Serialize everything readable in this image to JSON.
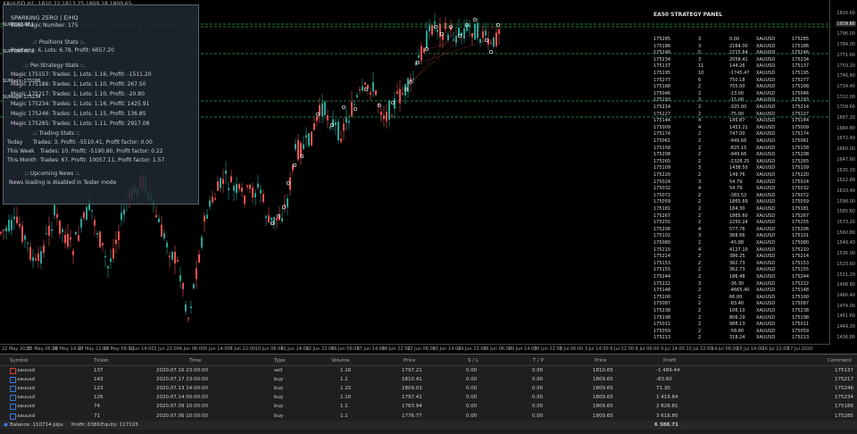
{
  "window": {
    "title": "XAUUSD,H1: 1810.22 1813.25 1809.18 1809.65"
  },
  "info_panel": {
    "header": "SPARKING ZERO | E/HQ",
    "base_magic": "Base Magic Number: 175",
    "positions_title": ".:: Positions Stats ::.",
    "positions_stat": "Positions: 6, Lots: 6.78, Profit: 6657.20",
    "per_strategy_title": ".:: Per-Strategy Stats ::.",
    "strategies": [
      "Magic 175157: Trades: 1, Lots: 1.16, Profit: -1511.20",
      "Magic 175186: Trades: 1, Lots: 1.10, Profit: 267.50",
      "Magic 175217: Trades: 1, Lots: 1.10, Profit: -20.80",
      "Magic 175234: Trades: 1, Lots: 1.16, Profit: 1425.91",
      "Magic 175246: Trades: 1, Lots: 1.15, Profit: 136.85",
      "Magic 175285: Trades: 1, Lots: 1.11, Profit: 2917.08"
    ],
    "trading_title": ".:: Trading Stats ::.",
    "trading": [
      {
        "label": "Today",
        "value": "Trades: 3, Profit: -5510.41, Profit factor: 0.00"
      },
      {
        "label": "This Week",
        "value": "Trades: 10, Profit: -5190.80, Profit factor: 0.22"
      },
      {
        "label": "This Month",
        "value": "Trades: 67, Profit: 10057.11, Profit factor: 1.57"
      }
    ],
    "news_title": ".:: Upcoming News ::.",
    "news_text": "News loading is disabled in Tester mode"
  },
  "chart_left_labels": [
    "SUPPORT-RT-1",
    "SUPPORT-RT-2",
    "SUMagic-175186",
    "SUMagic-175234"
  ],
  "strategy_panel": {
    "title": "EA50 STRATEGY PANEL",
    "rows": [
      [
        "175285",
        "3",
        "0.00",
        "XAUUSD",
        "175285"
      ],
      [
        "175186",
        "3",
        "2164.00",
        "XAUUSD",
        "175186"
      ],
      [
        "175246",
        "5",
        "2715.64",
        "XAUUSD",
        "175246"
      ],
      [
        "175234",
        "3",
        "2058.41",
        "XAUUSD",
        "175234"
      ],
      [
        "175137",
        "11",
        "144.26",
        "XAUUSD",
        "175137"
      ],
      [
        "175195",
        "10",
        "-1745.47",
        "XAUUSD",
        "175195"
      ],
      [
        "175277",
        "6",
        "750.18",
        "XAUUSD",
        "175277"
      ],
      [
        "175168",
        "2",
        "705.00",
        "XAUUSD",
        "175168"
      ],
      [
        "175046",
        "2",
        "-13.00",
        "XAUUSD",
        "175046"
      ],
      [
        "175193",
        "3",
        "-15.00",
        "XAUUSD",
        "175193"
      ],
      [
        "175214",
        "2",
        "-325.00",
        "XAUUSD",
        "175214"
      ],
      [
        "175227",
        "2",
        "-75.00",
        "XAUUSD",
        "175227"
      ],
      [
        "175144",
        "4",
        "145.87",
        "XAUUSD",
        "175144"
      ],
      [
        "175009",
        "4",
        "1453.21",
        "XAUUSD",
        "175009"
      ],
      [
        "175174",
        "2",
        "747.00",
        "XAUUSD",
        "175174"
      ],
      [
        "175061",
        "2",
        "-949.66",
        "XAUUSD",
        "175061"
      ],
      [
        "175158",
        "2",
        "-825.15",
        "XAUUSD",
        "175158"
      ],
      [
        "175208",
        "2",
        "-949.66",
        "XAUUSD",
        "175208"
      ],
      [
        "175265",
        "2",
        "-2328.25",
        "XAUUSD",
        "175265"
      ],
      [
        "175109",
        "3",
        "1438.50",
        "XAUUSD",
        "175109"
      ],
      [
        "175220",
        "2",
        "149.76",
        "XAUUSD",
        "175220"
      ],
      [
        "175024",
        "3",
        "54.79",
        "XAUUSD",
        "175024"
      ],
      [
        "175032",
        "4",
        "54.79",
        "XAUUSD",
        "175032"
      ],
      [
        "175072",
        "2",
        "-383.52",
        "XAUUSD",
        "175072"
      ],
      [
        "175059",
        "2",
        "1865.69",
        "XAUUSD",
        "175059"
      ],
      [
        "175181",
        "2",
        "184.30",
        "XAUUSD",
        "175181"
      ],
      [
        "175267",
        "2",
        "1865.60",
        "XAUUSD",
        "175267"
      ],
      [
        "175255",
        "2",
        "2250.24",
        "XAUUSD",
        "175255"
      ],
      [
        "175206",
        "4",
        "577.76",
        "XAUUSD",
        "175206"
      ],
      [
        "175101",
        "3",
        "368.66",
        "XAUUSD",
        "175101"
      ],
      [
        "175080",
        "2",
        "-45.88",
        "XAUUSD",
        "175080"
      ],
      [
        "175210",
        "4",
        "4127.10",
        "XAUUSD",
        "175210"
      ],
      [
        "175214",
        "2",
        "386.25",
        "XAUUSD",
        "175214"
      ],
      [
        "175153",
        "2",
        "362.73",
        "XAUUSD",
        "175153"
      ],
      [
        "175155",
        "2",
        "362.73",
        "XAUUSD",
        "175155"
      ],
      [
        "175244",
        "2",
        "186.48",
        "XAUUSD",
        "175244"
      ],
      [
        "175222",
        "3",
        "-36.30",
        "XAUUSD",
        "175222"
      ],
      [
        "175148",
        "2",
        "-4665.40",
        "XAUUSD",
        "175148"
      ],
      [
        "175100",
        "2",
        "66.00",
        "XAUUSD",
        "175100"
      ],
      [
        "175087",
        "2",
        "-83.40",
        "XAUUSD",
        "175087"
      ],
      [
        "175238",
        "2",
        "106.10",
        "XAUUSD",
        "175238"
      ],
      [
        "175198",
        "2",
        "806.29",
        "XAUUSD",
        "175198"
      ],
      [
        "175011",
        "2",
        "988.13",
        "XAUUSD",
        "175011"
      ],
      [
        "175059",
        "2",
        "-58.80",
        "XAUUSD",
        "175059"
      ],
      [
        "175213",
        "2",
        "318.24",
        "XAUUSD",
        "175213"
      ]
    ]
  },
  "price_axis": [
    "1816.60",
    "1808.70",
    "1796.00",
    "1784.00",
    "1771.60",
    "1759.20",
    "1746.80",
    "1734.40",
    "1722.00",
    "1709.60",
    "1697.20",
    "1684.80",
    "1672.40",
    "1660.00",
    "1647.60",
    "1635.20",
    "1622.80",
    "1610.40",
    "1598.00",
    "1585.60",
    "1573.20",
    "1560.80",
    "1548.40",
    "1536.00",
    "1523.60",
    "1511.20",
    "1498.80",
    "1486.40",
    "1474.00",
    "1461.60",
    "1449.20",
    "1436.80"
  ],
  "current_price": "1809.65",
  "time_axis": [
    "22 May 2020",
    "25 May 06:00",
    "26 May 14:00",
    "27 May 22:00",
    "29 May 06:00",
    "1 Jun 14:00",
    "2 Jun 22:00",
    "4 Jun 06:00",
    "5 Jun 14:00",
    "8 Jun 22:00",
    "10 Jun 06:00",
    "11 Jun 14:00",
    "12 Jun 22:00",
    "16 Jun 06:00",
    "17 Jun 14:00",
    "18 Jun 22:00",
    "22 Jun 06:00",
    "23 Jun 14:00",
    "24 Jun 22:00",
    "26 Jun 06:00",
    "29 Jun 14:00",
    "30 Jun 22:00",
    "2 Jul 06:00",
    "3 Jul 14:00",
    "6 Jul 22:00",
    "8 Jul 06:00",
    "9 Jul 14:00",
    "10 Jul 22:00",
    "14 Jul 06:00",
    "15 Jul 14:00",
    "16 Jul 22:00",
    "17 Jul 2020"
  ],
  "terminal": {
    "columns": [
      "Symbol",
      "Ticket",
      "Time",
      "Type",
      "Volume",
      "Price",
      "S / L",
      "T / P",
      "Price",
      "Profit",
      "Comment"
    ],
    "rows": [
      {
        "symbol": "xauusd",
        "ticket": "137",
        "time": "2020.07.16 23:00:00",
        "type": "sell",
        "volume": "1.16",
        "price": "1797.21",
        "sl": "0.00",
        "tp": "0.00",
        "cur": "1810.65",
        "profit": "-1 489.44",
        "comment": "175137",
        "color": "#e04040"
      },
      {
        "symbol": "xauusd",
        "ticket": "143",
        "time": "2020.07.17 23:00:00",
        "type": "buy",
        "volume": "1.1",
        "price": "1810.41",
        "sl": "0.00",
        "tp": "0.00",
        "cur": "1809.65",
        "profit": "-83.60",
        "comment": "175217",
        "color": "#3a7de0"
      },
      {
        "symbol": "xauusd",
        "ticket": "123",
        "time": "2020.07.13 14:00:00",
        "type": "buy",
        "volume": "1.15",
        "price": "1809.03",
        "sl": "0.00",
        "tp": "0.00",
        "cur": "1809.65",
        "profit": "71.30",
        "comment": "175246",
        "color": "#3a7de0"
      },
      {
        "symbol": "xauusd",
        "ticket": "126",
        "time": "2020.07.14 00:00:00",
        "type": "buy",
        "volume": "1.16",
        "price": "1797.41",
        "sl": "0.00",
        "tp": "0.00",
        "cur": "1809.65",
        "profit": "1 419.84",
        "comment": "175234",
        "color": "#3a7de0"
      },
      {
        "symbol": "xauusd",
        "ticket": "74",
        "time": "2020.07.09 10:00:00",
        "type": "buy",
        "volume": "1.1",
        "price": "1783.94",
        "sl": "0.00",
        "tp": "0.00",
        "cur": "1809.65",
        "profit": "2 828.81",
        "comment": "175186",
        "color": "#3a7de0"
      },
      {
        "symbol": "xauusd",
        "ticket": "71",
        "time": "2020.07.06 10:00:00",
        "type": "buy",
        "volume": "1.1",
        "price": "1776.77",
        "sl": "0.00",
        "tp": "0.00",
        "cur": "1809.65",
        "profit": "3 618.80",
        "comment": "175285",
        "color": "#3a7de0"
      }
    ],
    "footer": {
      "balance": "Balance: 110714 pips",
      "profit": "Profit: 6389",
      "equity": "Equity: 117103",
      "total": "6 388.71"
    }
  },
  "colors": {
    "bull": "#26a69a",
    "bear": "#ef5350",
    "grid_line": "#2aa84a",
    "accent": "#3a7de0"
  }
}
